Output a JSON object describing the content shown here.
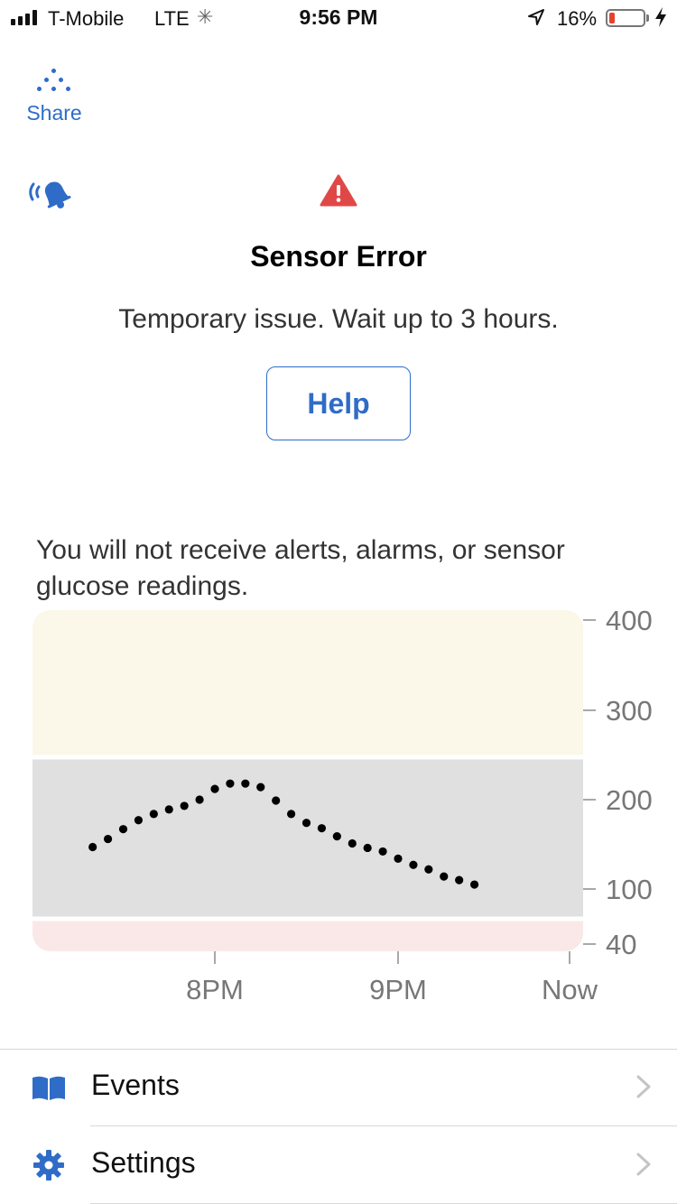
{
  "status_bar": {
    "carrier": "T-Mobile",
    "network": "LTE",
    "time": "9:56 PM",
    "battery_percent": "16%",
    "battery_level": 0.16,
    "icons": [
      "signal-icon",
      "loading-icon",
      "location-arrow-icon",
      "battery-icon",
      "charging-icon"
    ]
  },
  "header": {
    "share_label": "Share",
    "share_icon": "share-dots-icon",
    "alert_icon": "ringing-bell-icon"
  },
  "error": {
    "icon": "warning-triangle-icon",
    "title": "Sensor Error",
    "message": "Temporary issue. Wait up to 3 hours.",
    "help_label": "Help"
  },
  "notice": "You will not receive alerts, alarms, or sensor glucose readings.",
  "chart_data": {
    "type": "scatter",
    "title": "",
    "xlabel": "",
    "ylabel": "",
    "x_ticks": [
      "8PM",
      "9PM",
      "Now"
    ],
    "y_ticks": [
      400,
      300,
      200,
      100,
      40
    ],
    "bands": [
      {
        "name": "high",
        "from": 250,
        "to": 400,
        "color": "#fbf7e9"
      },
      {
        "name": "target",
        "from": 70,
        "to": 245,
        "color": "#e0e0e0"
      },
      {
        "name": "low",
        "from": 40,
        "to": 65,
        "color": "#fae8e8"
      }
    ],
    "x_range_minutes": [
      -100,
      0
    ],
    "x_tick_minutes": [
      -60,
      0,
      0
    ],
    "points": [
      {
        "t": -100,
        "v": 147
      },
      {
        "t": -95,
        "v": 156
      },
      {
        "t": -90,
        "v": 167
      },
      {
        "t": -85,
        "v": 177
      },
      {
        "t": -80,
        "v": 184
      },
      {
        "t": -75,
        "v": 189
      },
      {
        "t": -70,
        "v": 193
      },
      {
        "t": -65,
        "v": 200
      },
      {
        "t": -60,
        "v": 212
      },
      {
        "t": -55,
        "v": 218
      },
      {
        "t": -50,
        "v": 218
      },
      {
        "t": -45,
        "v": 214
      },
      {
        "t": -40,
        "v": 199
      },
      {
        "t": -35,
        "v": 184
      },
      {
        "t": -30,
        "v": 174
      },
      {
        "t": -25,
        "v": 168
      },
      {
        "t": -20,
        "v": 159
      },
      {
        "t": -15,
        "v": 151
      },
      {
        "t": -10,
        "v": 146
      },
      {
        "t": -5,
        "v": 142
      },
      {
        "t": 0,
        "v": 134
      },
      {
        "t": 5,
        "v": 127
      },
      {
        "t": 10,
        "v": 122
      },
      {
        "t": 15,
        "v": 114
      },
      {
        "t": 20,
        "v": 110
      },
      {
        "t": 25,
        "v": 105
      }
    ]
  },
  "menu": {
    "items": [
      {
        "label": "Events",
        "icon": "book-icon"
      },
      {
        "label": "Settings",
        "icon": "gear-icon"
      }
    ]
  },
  "colors": {
    "accent": "#2f6cc7",
    "warning": "#e04848",
    "battery_low": "#e5412f"
  }
}
